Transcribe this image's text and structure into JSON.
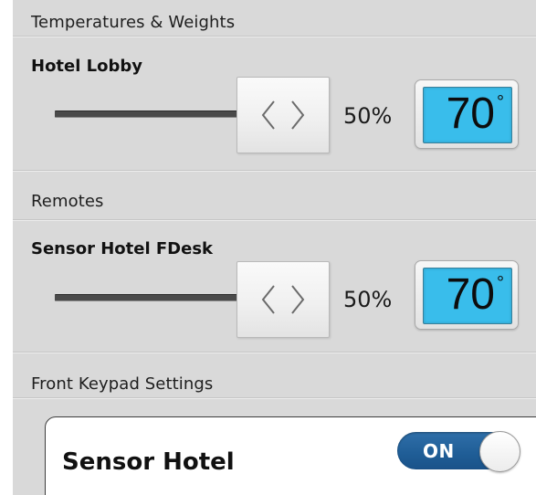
{
  "sections": {
    "temperatures_weights": "Temperatures & Weights",
    "remotes": "Remotes",
    "front_keypad": "Front Keypad Settings"
  },
  "zones": [
    {
      "title": "Hotel Lobby",
      "level_percent": "50%",
      "temperature": "70",
      "degree_symbol": "°"
    },
    {
      "title": "Sensor Hotel FDesk",
      "level_percent": "50%",
      "temperature": "70",
      "degree_symbol": "°"
    }
  ],
  "keypad": {
    "label": "Sensor Hotel",
    "toggle_state": "ON"
  },
  "colors": {
    "panel_background": "#d9d9d9",
    "temperature_display": "#39bdeb",
    "toggle_on": "#1f5d96"
  },
  "icons": {
    "slider_thumb": "chevron-left-right-icon"
  }
}
